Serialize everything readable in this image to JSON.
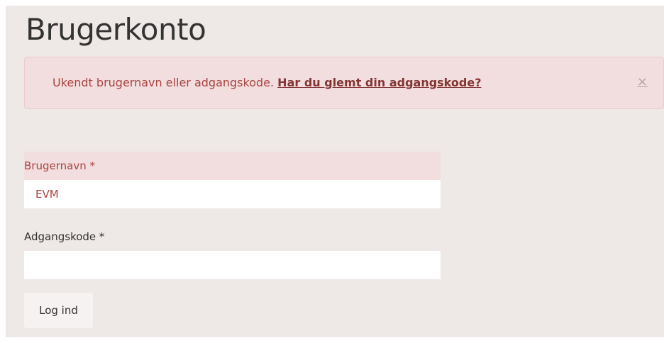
{
  "page": {
    "title": "Brugerkonto"
  },
  "alert": {
    "message": "Ukendt brugernavn eller adgangskode. ",
    "link_text": "Har du glemt din adgangskode?",
    "close_glyph": "×"
  },
  "form": {
    "username": {
      "label": "Brugernavn *",
      "value": "EVM"
    },
    "password": {
      "label": "Adgangskode *",
      "value": ""
    },
    "submit_label": "Log ind"
  },
  "colors": {
    "page_background": "#eee9e6",
    "alert_background": "#f2dede",
    "alert_text": "#a94442",
    "alert_link": "#843534"
  }
}
